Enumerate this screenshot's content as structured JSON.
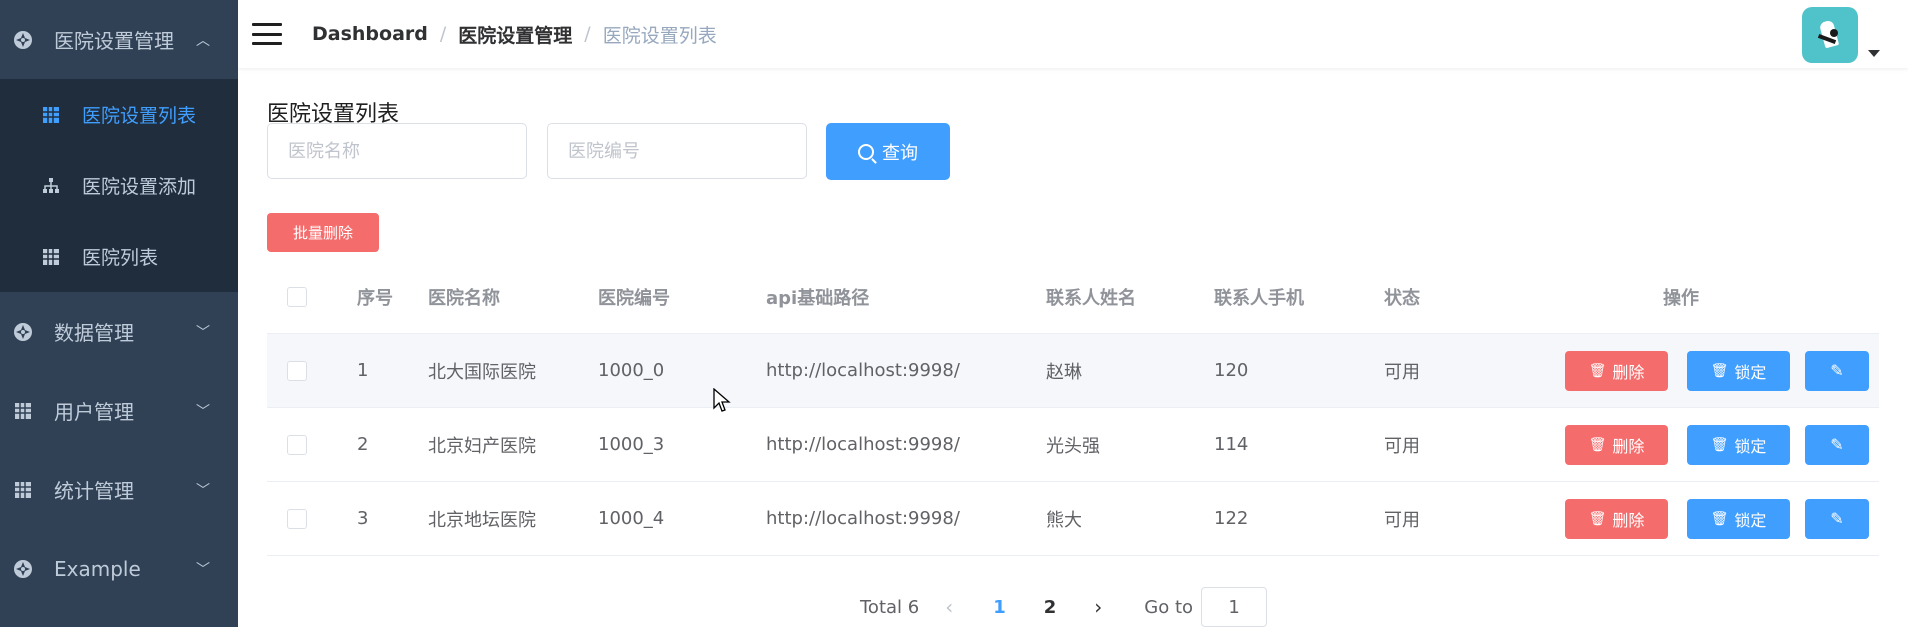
{
  "sidebar": {
    "groups": [
      {
        "label": "医院设置管理",
        "icon": "settings-gear-icon",
        "expanded": true,
        "items": [
          {
            "label": "医院设置列表",
            "icon": "table-icon",
            "active": true
          },
          {
            "label": "医院设置添加",
            "icon": "tree-icon",
            "active": false
          },
          {
            "label": "医院列表",
            "icon": "table-icon",
            "active": false
          }
        ]
      },
      {
        "label": "数据管理",
        "icon": "settings-gear-icon",
        "expanded": false
      },
      {
        "label": "用户管理",
        "icon": "table-icon",
        "expanded": false
      },
      {
        "label": "统计管理",
        "icon": "table-icon",
        "expanded": false
      },
      {
        "label": "Example",
        "icon": "settings-gear-icon",
        "expanded": false
      }
    ]
  },
  "navbar": {
    "breadcrumb": [
      "Dashboard",
      "医院设置管理",
      "医院设置列表"
    ]
  },
  "page": {
    "title": "医院设置列表",
    "search": {
      "name_placeholder": "医院名称",
      "code_placeholder": "医院编号",
      "query_label": "查询"
    },
    "batch_delete_label": "批量删除"
  },
  "table": {
    "headers": {
      "index": "序号",
      "name": "医院名称",
      "code": "医院编号",
      "api": "api基础路径",
      "contact": "联系人姓名",
      "phone": "联系人手机",
      "status": "状态",
      "ops": "操作"
    },
    "rows": [
      {
        "index": "1",
        "name": "北大国际医院",
        "code": "1000_0",
        "api": "http://localhost:9998/",
        "contact": "赵琳",
        "phone": "120",
        "status": "可用"
      },
      {
        "index": "2",
        "name": "北京妇产医院",
        "code": "1000_3",
        "api": "http://localhost:9998/",
        "contact": "光头强",
        "phone": "114",
        "status": "可用"
      },
      {
        "index": "3",
        "name": "北京地坛医院",
        "code": "1000_4",
        "api": "http://localhost:9998/",
        "contact": "熊大",
        "phone": "122",
        "status": "可用"
      }
    ],
    "row_actions": {
      "delete": "删除",
      "lock": "锁定"
    }
  },
  "pagination": {
    "total_text": "Total 6",
    "pages": [
      "1",
      "2"
    ],
    "current": "1",
    "goto_label": "Go to",
    "goto_value": "1"
  },
  "colors": {
    "sidebar_bg": "#304156",
    "submenu_bg": "#1f2d3d",
    "primary": "#409eff",
    "danger": "#f56c6c"
  }
}
